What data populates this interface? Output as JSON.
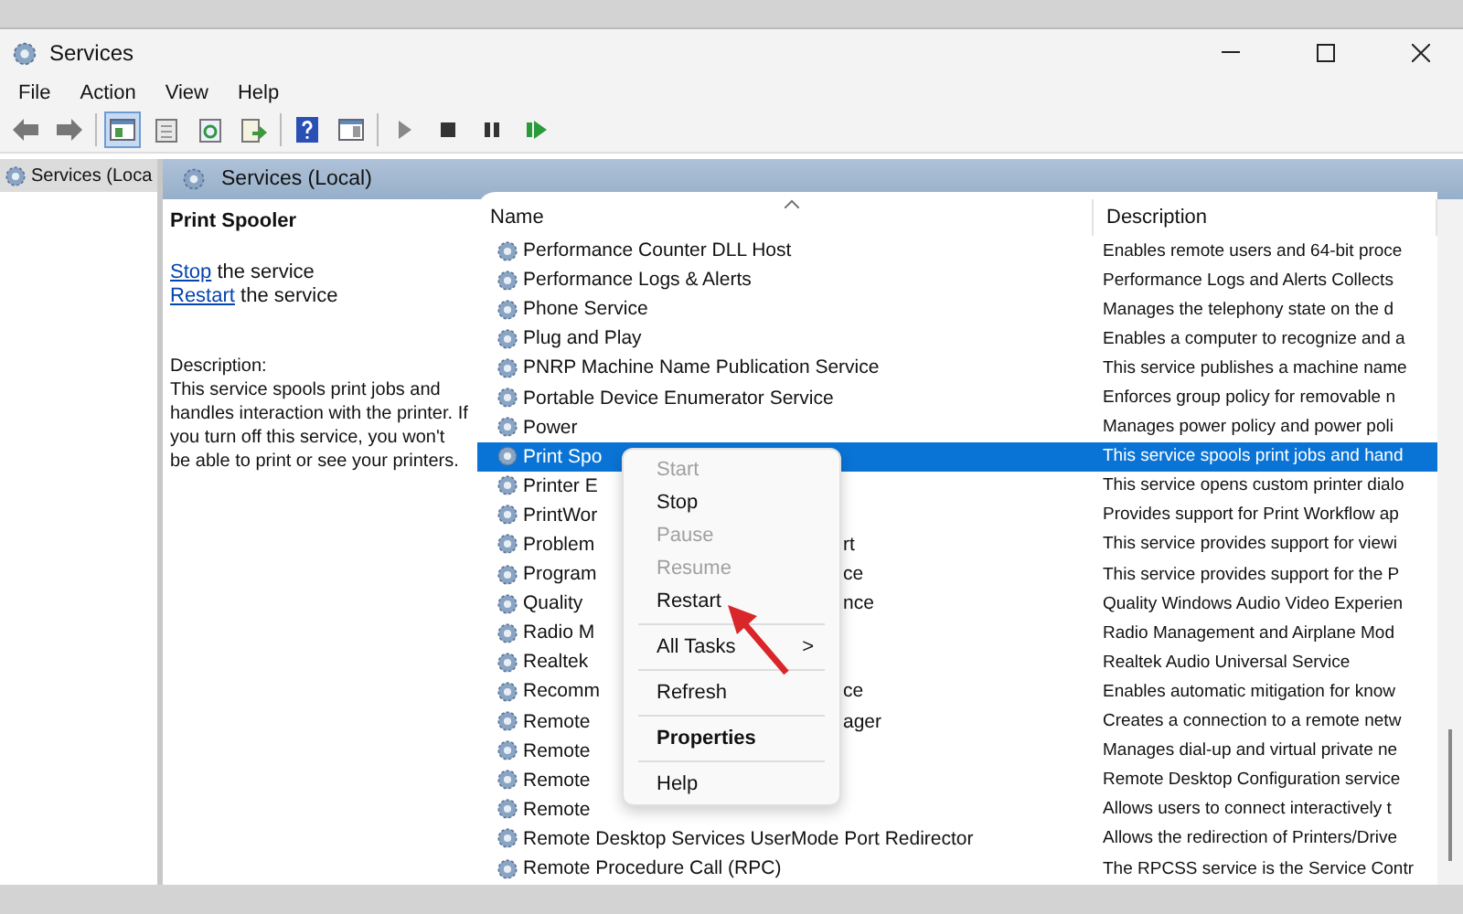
{
  "window": {
    "title": "Services"
  },
  "menu_bar": [
    {
      "label": "File"
    },
    {
      "label": "Action"
    },
    {
      "label": "View"
    },
    {
      "label": "Help"
    }
  ],
  "toolbar": [
    {
      "kind": "back",
      "pressed": false
    },
    {
      "kind": "forward",
      "pressed": false
    },
    {
      "kind": "separator"
    },
    {
      "kind": "tree",
      "pressed": true
    },
    {
      "kind": "properties",
      "pressed": false
    },
    {
      "kind": "refresh",
      "pressed": false
    },
    {
      "kind": "export",
      "pressed": false
    },
    {
      "kind": "separator"
    },
    {
      "kind": "help",
      "pressed": false
    },
    {
      "kind": "console",
      "pressed": false
    },
    {
      "kind": "separator"
    },
    {
      "kind": "play",
      "pressed": false
    },
    {
      "kind": "stop",
      "pressed": false
    },
    {
      "kind": "pause",
      "pressed": false
    },
    {
      "kind": "resume",
      "pressed": false
    }
  ],
  "tree": [
    {
      "label": "Services (Loca",
      "selected": true
    }
  ],
  "panel": {
    "title": "Services (Local)",
    "detail": {
      "title": "Print Spooler",
      "actions": [
        {
          "link": "Stop",
          "text": "the service"
        },
        {
          "link": "Restart",
          "text": "the service"
        }
      ],
      "description_label": "Description:",
      "description": "This service spools print jobs and handles interaction with the printer. If you turn off this service, you won't be able to print or see your printers."
    },
    "columns": [
      {
        "label": "Name",
        "sorted": true
      },
      {
        "label": "Description",
        "sorted": false
      }
    ],
    "rows": [
      {
        "name": "Performance Counter DLL Host",
        "description": "Enables remote users and 64-bit proce",
        "selected": false
      },
      {
        "name": "Performance Logs & Alerts",
        "description": "Performance Logs and Alerts Collects",
        "selected": false
      },
      {
        "name": "Phone Service",
        "description": "Manages the telephony state on the d",
        "selected": false
      },
      {
        "name": "Plug and Play",
        "description": "Enables a computer to recognize and a",
        "selected": false
      },
      {
        "name": "PNRP Machine Name Publication Service",
        "description": "This service publishes a machine name",
        "selected": false
      },
      {
        "name": "Portable Device Enumerator Service",
        "description": "Enforces group policy for removable n",
        "selected": false
      },
      {
        "name": "Power",
        "description": "Manages power policy and power poli",
        "selected": false
      },
      {
        "name": "Print Spo",
        "description": "This service spools print jobs and hand",
        "selected": true
      },
      {
        "name": "Printer E",
        "description": "This service opens custom printer dialo",
        "selected": false
      },
      {
        "name": "PrintWor",
        "description": "Provides support for Print Workflow ap",
        "selected": false
      },
      {
        "name": "Problem",
        "name_tail": "rt",
        "description": "This service provides support for viewi",
        "selected": false
      },
      {
        "name": "Program",
        "name_tail": "ce",
        "description": "This service provides support for the P",
        "selected": false
      },
      {
        "name": "Quality",
        "name_tail": "nce",
        "description": "Quality Windows Audio Video Experien",
        "selected": false
      },
      {
        "name": "Radio M",
        "description": "Radio Management and Airplane Mod",
        "selected": false
      },
      {
        "name": "Realtek",
        "description": "Realtek Audio Universal Service",
        "selected": false
      },
      {
        "name": "Recomm",
        "name_tail": "ce",
        "description": "Enables automatic mitigation for know",
        "selected": false
      },
      {
        "name": "Remote",
        "name_tail": "ager",
        "description": "Creates a connection to a remote netw",
        "selected": false
      },
      {
        "name": "Remote",
        "description": "Manages dial-up and virtual private ne",
        "selected": false
      },
      {
        "name": "Remote",
        "description": "Remote Desktop Configuration service",
        "selected": false
      },
      {
        "name": "Remote",
        "description": "Allows users to connect interactively t",
        "selected": false
      },
      {
        "name": "Remote Desktop Services UserMode Port Redirector",
        "description": "Allows the redirection of Printers/Drive",
        "selected": false
      },
      {
        "name": "Remote Procedure Call (RPC)",
        "description": "The RPCSS service is the Service Contr",
        "selected": false
      }
    ]
  },
  "context_menu": [
    {
      "kind": "item",
      "label": "Start",
      "disabled": true,
      "default": false
    },
    {
      "kind": "item",
      "label": "Stop",
      "disabled": false,
      "default": false
    },
    {
      "kind": "item",
      "label": "Pause",
      "disabled": true,
      "default": false
    },
    {
      "kind": "item",
      "label": "Resume",
      "disabled": true,
      "default": false
    },
    {
      "kind": "item",
      "label": "Restart",
      "disabled": false,
      "default": false
    },
    {
      "kind": "separator"
    },
    {
      "kind": "item",
      "label": "All Tasks",
      "arrow": ">",
      "disabled": false,
      "default": false
    },
    {
      "kind": "separator"
    },
    {
      "kind": "item",
      "label": "Refresh",
      "disabled": false,
      "default": false
    },
    {
      "kind": "separator"
    },
    {
      "kind": "item",
      "label": "Properties",
      "disabled": false,
      "default": true
    },
    {
      "kind": "separator"
    },
    {
      "kind": "item",
      "label": "Help",
      "disabled": false,
      "default": false
    }
  ]
}
